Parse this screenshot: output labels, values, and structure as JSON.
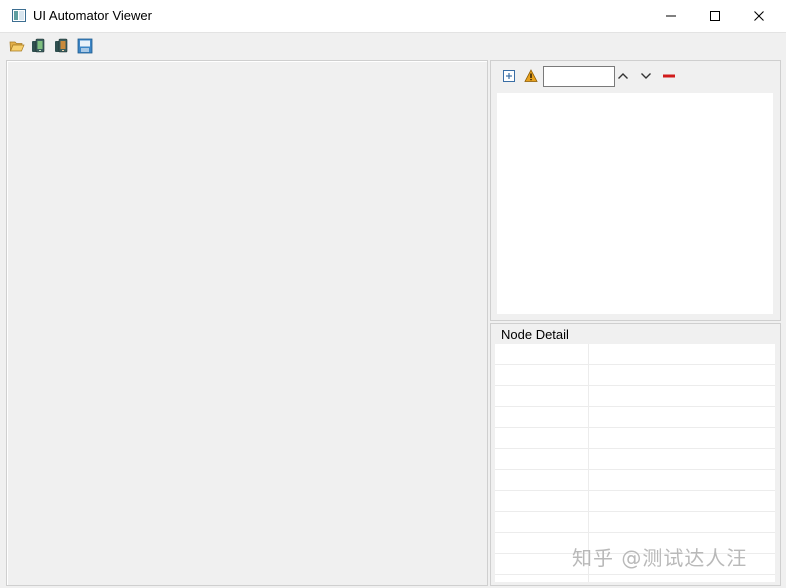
{
  "window": {
    "title": "UI Automator Viewer",
    "controls": [
      "minimize",
      "maximize",
      "close"
    ]
  },
  "toolbar": {
    "icons": [
      "open-folder-icon",
      "device-screenshot-icon",
      "device-screenshot-compressed-icon",
      "save-icon"
    ]
  },
  "hierarchy_panel": {
    "toolbar_icons": [
      "expand-all-icon",
      "warning-icon",
      "previous-icon",
      "next-icon",
      "clear-icon"
    ],
    "search": {
      "value": "",
      "placeholder": ""
    }
  },
  "node_detail": {
    "label": "Node Detail"
  },
  "watermark": "知乎 @测试达人汪",
  "colors": {
    "background": "#f0f0f0",
    "panel_white": "#ffffff",
    "warning": "#e8a21f",
    "clear_red": "#d11b1b",
    "icon_blue": "#2b6cb0"
  }
}
